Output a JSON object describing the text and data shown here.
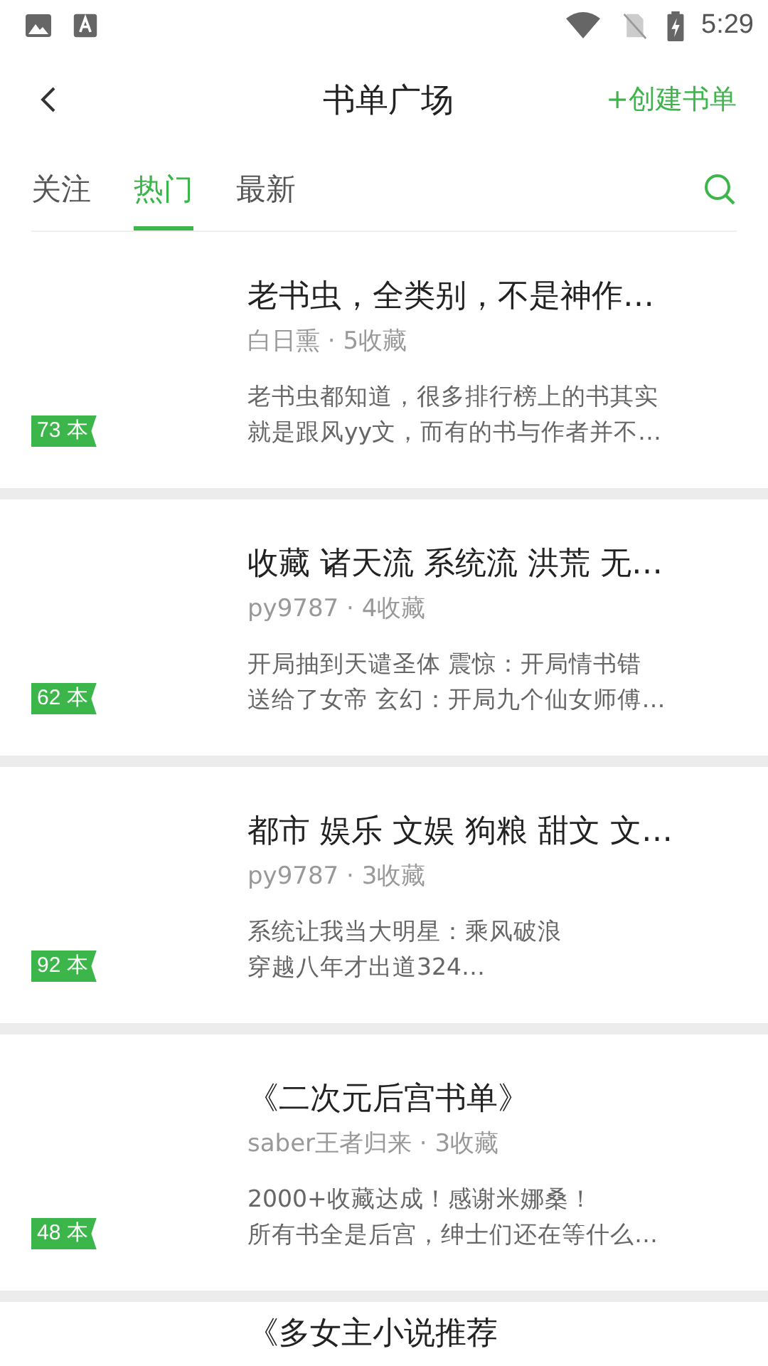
{
  "status_bar": {
    "time": "5:29"
  },
  "header": {
    "title": "书单广场",
    "action": "+创建书单"
  },
  "tabs": [
    {
      "label": "关注",
      "selected": false
    },
    {
      "label": "热门",
      "selected": true
    },
    {
      "label": "最新",
      "selected": false
    }
  ],
  "booklists": [
    {
      "count": "73 本",
      "title": "老书虫，全类别，不是神作…",
      "meta": "白日熏 · 5收藏",
      "description": [
        "老书虫都知道，很多排行榜上的书其实",
        "就是跟风yy文，而有的书与作者并不…"
      ]
    },
    {
      "count": "62 本",
      "title": "收藏 诸天流 系统流 洪荒 无…",
      "meta": "py9787 · 4收藏",
      "description": [
        "开局抽到天谴圣体 震惊：开局情书错",
        "送给了女帝 玄幻：开局九个仙女师傅…"
      ]
    },
    {
      "count": "92 本",
      "title": "都市 娱乐 文娱 狗粮 甜文 文…",
      "meta": "py9787 · 3收藏",
      "description": [
        "系统让我当大明星：乘风破浪",
        "穿越八年才出道324…"
      ]
    },
    {
      "count": "48 本",
      "title": "《二次元后宫书单》",
      "meta": "saber王者归来 · 3收藏",
      "description": [
        "2000+收藏达成！感谢米娜桑！",
        "所有书全是后宫，绅士们还在等什么…"
      ]
    },
    {
      "title": "《多女主小说推荐"
    }
  ]
}
